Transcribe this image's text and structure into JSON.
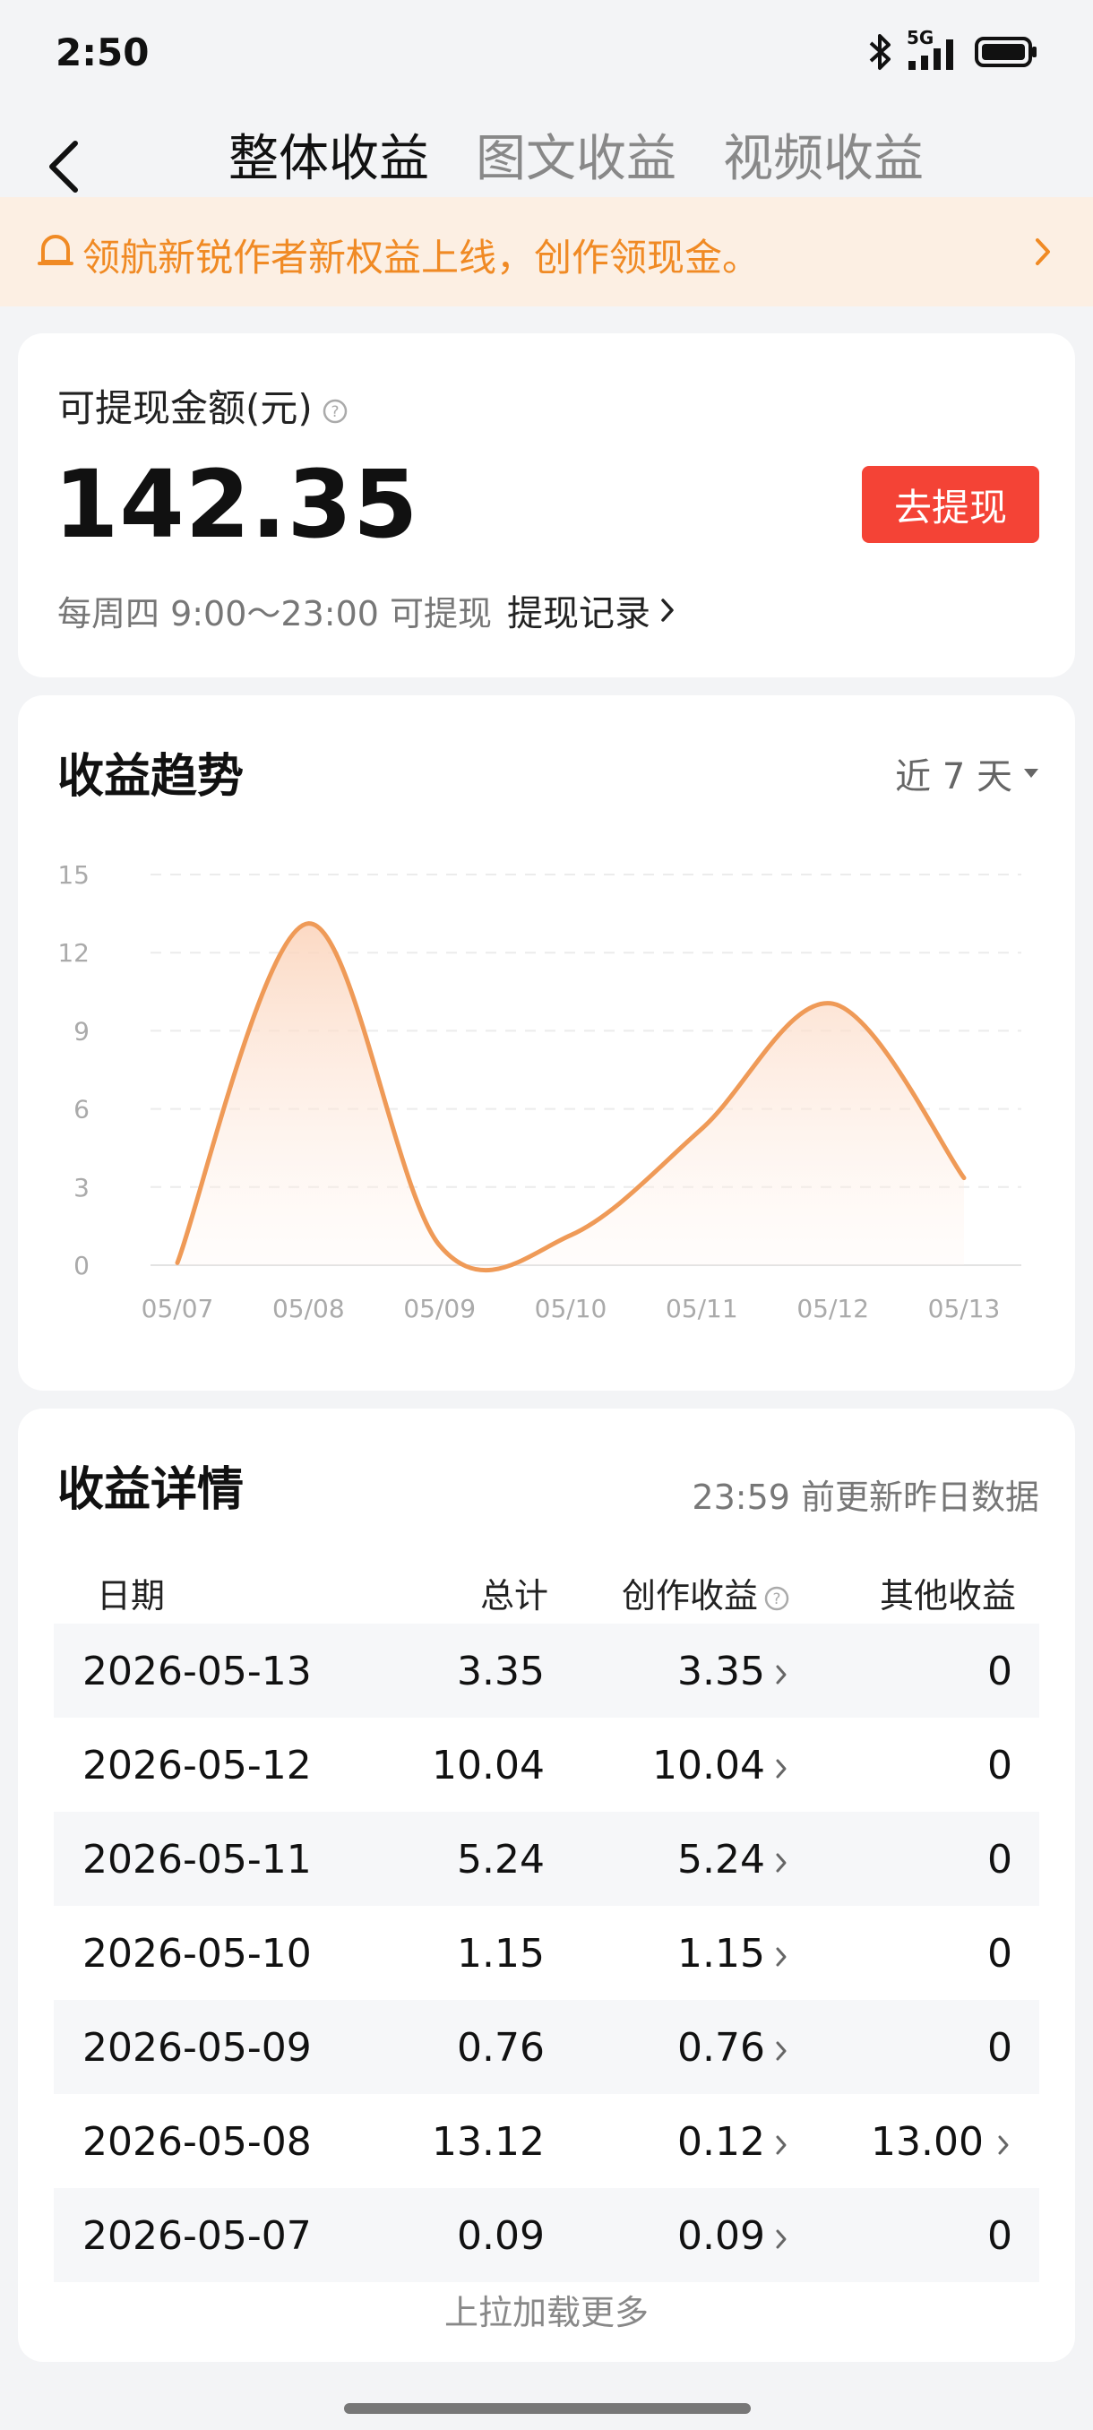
{
  "status_bar": {
    "time": "2:50",
    "network": "5G",
    "icons": [
      "bluetooth-icon",
      "signal-icon",
      "battery-icon"
    ]
  },
  "header": {
    "tabs": [
      {
        "label": "整体收益",
        "active": true
      },
      {
        "label": "图文收益",
        "active": false
      },
      {
        "label": "视频收益",
        "active": false
      }
    ]
  },
  "notice": {
    "text": "领航新锐作者新权益上线，创作领现金。",
    "color": "#f08a24"
  },
  "balance": {
    "label": "可提现金额(元)",
    "amount": "142.35",
    "withdraw_button": "去提现",
    "schedule": "每周四 9:00～23:00 可提现",
    "record_link": "提现记录"
  },
  "trend": {
    "title": "收益趋势",
    "range": "近 7 天"
  },
  "chart_data": {
    "type": "line",
    "categories": [
      "05/07",
      "05/08",
      "05/09",
      "05/10",
      "05/11",
      "05/12",
      "05/13"
    ],
    "series": [
      {
        "values": [
          0.09,
          13.12,
          0.76,
          1.15,
          5.24,
          10.04,
          3.35
        ],
        "color": "#ef9a57"
      }
    ],
    "y_ticks": [
      0,
      3,
      6,
      9,
      12,
      15
    ],
    "ylim": [
      0,
      15
    ],
    "grid": true,
    "smooth": true,
    "area_fill": true
  },
  "details": {
    "title": "收益详情",
    "note": "23:59 前更新昨日数据",
    "columns": {
      "date": "日期",
      "total": "总计",
      "creation": "创作收益",
      "other": "其他收益"
    },
    "rows": [
      {
        "date": "2026-05-13",
        "total": "3.35",
        "creation": "3.35",
        "other": "0"
      },
      {
        "date": "2026-05-12",
        "total": "10.04",
        "creation": "10.04",
        "other": "0"
      },
      {
        "date": "2026-05-11",
        "total": "5.24",
        "creation": "5.24",
        "other": "0"
      },
      {
        "date": "2026-05-10",
        "total": "1.15",
        "creation": "1.15",
        "other": "0"
      },
      {
        "date": "2026-05-09",
        "total": "0.76",
        "creation": "0.76",
        "other": "0"
      },
      {
        "date": "2026-05-08",
        "total": "13.12",
        "creation": "0.12",
        "other": "13.00",
        "other_link": true
      },
      {
        "date": "2026-05-07",
        "total": "0.09",
        "creation": "0.09",
        "other": "0"
      }
    ],
    "load_more": "上拉加载更多"
  }
}
